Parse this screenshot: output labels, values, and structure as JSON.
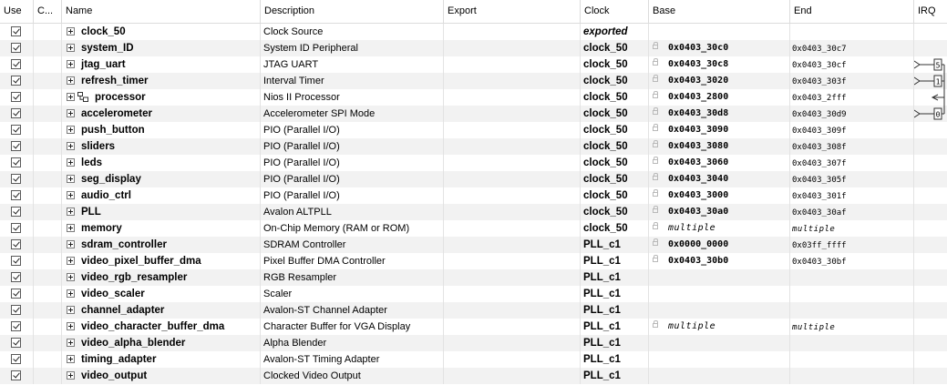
{
  "columns": {
    "use": "Use",
    "conn": "C...",
    "name": "Name",
    "desc": "Description",
    "export": "Export",
    "clock": "Clock",
    "base": "Base",
    "end": "End",
    "irq": "IRQ"
  },
  "rows": [
    {
      "name": "clock_50",
      "desc": "Clock Source",
      "clock": "exported",
      "base": "",
      "end": "",
      "irq": ""
    },
    {
      "name": "system_ID",
      "desc": "System ID Peripheral",
      "clock": "clock_50",
      "base": "0x0403_30c0",
      "end": "0x0403_30c7",
      "irq": ""
    },
    {
      "name": "jtag_uart",
      "desc": "JTAG UART",
      "clock": "clock_50",
      "base": "0x0403_30c8",
      "end": "0x0403_30cf",
      "irq": "5"
    },
    {
      "name": "refresh_timer",
      "desc": "Interval Timer",
      "clock": "clock_50",
      "base": "0x0403_3020",
      "end": "0x0403_303f",
      "irq": "1"
    },
    {
      "name": "processor",
      "desc": "Nios II Processor",
      "clock": "clock_50",
      "base": "0x0403_2800",
      "end": "0x0403_2fff",
      "irq": ""
    },
    {
      "name": "accelerometer",
      "desc": "Accelerometer SPI Mode",
      "clock": "clock_50",
      "base": "0x0403_30d8",
      "end": "0x0403_30d9",
      "irq": "0"
    },
    {
      "name": "push_button",
      "desc": "PIO (Parallel I/O)",
      "clock": "clock_50",
      "base": "0x0403_3090",
      "end": "0x0403_309f",
      "irq": ""
    },
    {
      "name": "sliders",
      "desc": "PIO (Parallel I/O)",
      "clock": "clock_50",
      "base": "0x0403_3080",
      "end": "0x0403_308f",
      "irq": ""
    },
    {
      "name": "leds",
      "desc": "PIO (Parallel I/O)",
      "clock": "clock_50",
      "base": "0x0403_3060",
      "end": "0x0403_307f",
      "irq": ""
    },
    {
      "name": "seg_display",
      "desc": "PIO (Parallel I/O)",
      "clock": "clock_50",
      "base": "0x0403_3040",
      "end": "0x0403_305f",
      "irq": ""
    },
    {
      "name": "audio_ctrl",
      "desc": "PIO (Parallel I/O)",
      "clock": "clock_50",
      "base": "0x0403_3000",
      "end": "0x0403_301f",
      "irq": ""
    },
    {
      "name": "PLL",
      "desc": "Avalon ALTPLL",
      "clock": "clock_50",
      "base": "0x0403_30a0",
      "end": "0x0403_30af",
      "irq": ""
    },
    {
      "name": "memory",
      "desc": "On-Chip Memory (RAM or ROM)",
      "clock": "clock_50",
      "base": "multiple",
      "end": "multiple",
      "irq": ""
    },
    {
      "name": "sdram_controller",
      "desc": "SDRAM Controller",
      "clock": "PLL_c1",
      "base": "0x0000_0000",
      "end": "0x03ff_ffff",
      "irq": ""
    },
    {
      "name": "video_pixel_buffer_dma",
      "desc": "Pixel Buffer DMA Controller",
      "clock": "PLL_c1",
      "base": "0x0403_30b0",
      "end": "0x0403_30bf",
      "irq": ""
    },
    {
      "name": "video_rgb_resampler",
      "desc": "RGB Resampler",
      "clock": "PLL_c1",
      "base": "",
      "end": "",
      "irq": ""
    },
    {
      "name": "video_scaler",
      "desc": "Scaler",
      "clock": "PLL_c1",
      "base": "",
      "end": "",
      "irq": ""
    },
    {
      "name": "channel_adapter",
      "desc": "Avalon-ST Channel Adapter",
      "clock": "PLL_c1",
      "base": "",
      "end": "",
      "irq": ""
    },
    {
      "name": "video_character_buffer_dma",
      "desc": "Character Buffer for VGA Display",
      "clock": "PLL_c1",
      "base": "multiple",
      "end": "multiple",
      "irq": ""
    },
    {
      "name": "video_alpha_blender",
      "desc": "Alpha Blender",
      "clock": "PLL_c1",
      "base": "",
      "end": "",
      "irq": ""
    },
    {
      "name": "timing_adapter",
      "desc": "Avalon-ST Timing Adapter",
      "clock": "PLL_c1",
      "base": "",
      "end": "",
      "irq": ""
    },
    {
      "name": "video_output",
      "desc": "Clocked Video Output",
      "clock": "PLL_c1",
      "base": "",
      "end": "",
      "irq": ""
    }
  ]
}
